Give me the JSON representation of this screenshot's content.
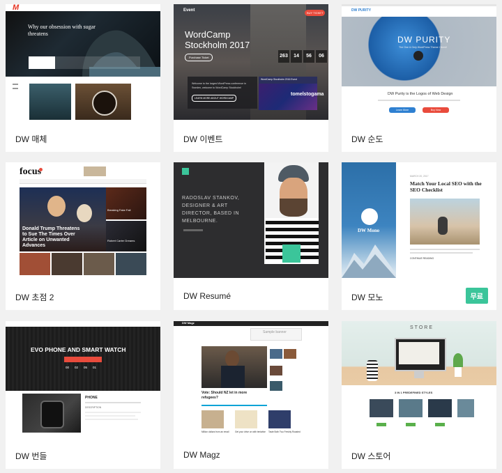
{
  "themes": [
    {
      "name": "DW 매체",
      "badge": "",
      "preview": {
        "logo": "M",
        "headline_line1": "Why our obsession with sugar",
        "headline_line2": "threatens"
      }
    },
    {
      "name": "DW 이벤트",
      "badge": "",
      "preview": {
        "logo": "Event",
        "cta": "BUY TICKET",
        "title_line1": "WordCamp",
        "title_line2": "Stockholm 2017",
        "button": "Purchase Ticket",
        "countdown": [
          "263",
          "14",
          "56",
          "06"
        ],
        "info_line1": "Welcome to the largest WordPress conference in",
        "info_line2": "Sweden, welcome to WordCamp Stockholm!",
        "info_button": "LEARN MORE ABOUT WORDCAMP",
        "video_title": "WordCamp Stockholm 2016 Event",
        "video_overlay": "tomelstogama"
      }
    },
    {
      "name": "DW 순도",
      "badge": "",
      "preview": {
        "logo": "DW PURITY",
        "hero_title": "DW PURITY",
        "hero_sub": "The One & Only WordPress Theme I Need!",
        "tagline": "DW Purity is the Logos of Web Design",
        "btn_primary": "Learn More",
        "btn_secondary": "Buy Now"
      }
    },
    {
      "name": "DW 초점 2",
      "badge": "",
      "preview": {
        "logo": "focus",
        "headline_line1": "Donald Trump Threatens",
        "headline_line2": "to Sue The Times Over",
        "headline_line3": "Article on Unwanted",
        "headline_line4": "Advances",
        "side1": "Breaking Fake Fail",
        "side2": "Robert Carter Dreams"
      }
    },
    {
      "name": "DW Resumé",
      "badge": "",
      "preview": {
        "intro_line1": "RADOSLAV STANKOV,",
        "intro_line2": "DESIGNER & ART",
        "intro_line3": "DIRECTOR, BASED IN",
        "intro_line4": "MELBOURNE."
      }
    },
    {
      "name": "DW 모노",
      "badge": "무료",
      "preview": {
        "logo": "DW Mono",
        "date": "MARCH 20, 2017",
        "title_line1": "Match Your Local SEO with the",
        "title_line2": "SEO Checklist",
        "read_more": "CONTINUE READING"
      }
    },
    {
      "name": "DW 번들",
      "badge": "",
      "preview": {
        "hero_title": "EVO PHONE AND SMART WATCH",
        "countdown": [
          "00",
          "02",
          "05",
          "01"
        ],
        "product_title": "PHONE",
        "section": "DESCRIPTION"
      }
    },
    {
      "name": "DW Magz",
      "badge": "",
      "preview": {
        "logo": "DW Magz",
        "ad_text": "Sample banner",
        "headline_line1": "Vote: Should NZ let in more",
        "headline_line2": "refugees?",
        "caption1": "Million dollars from an email",
        "caption2": "Get your drive on with tentative",
        "caption3": "Taste Both Two Freshly Roasted"
      }
    },
    {
      "name": "DW 스토어",
      "badge": "",
      "preview": {
        "logo": "STORE",
        "section_title": "3 IN 1 PREDEFINED STYLES"
      }
    }
  ],
  "colors": {
    "page_bg": "#f1f1f1",
    "card_bg": "#ffffff",
    "badge_green": "#3bc59a",
    "accent_red": "#e94b3c",
    "accent_blue": "#2f80d1"
  }
}
